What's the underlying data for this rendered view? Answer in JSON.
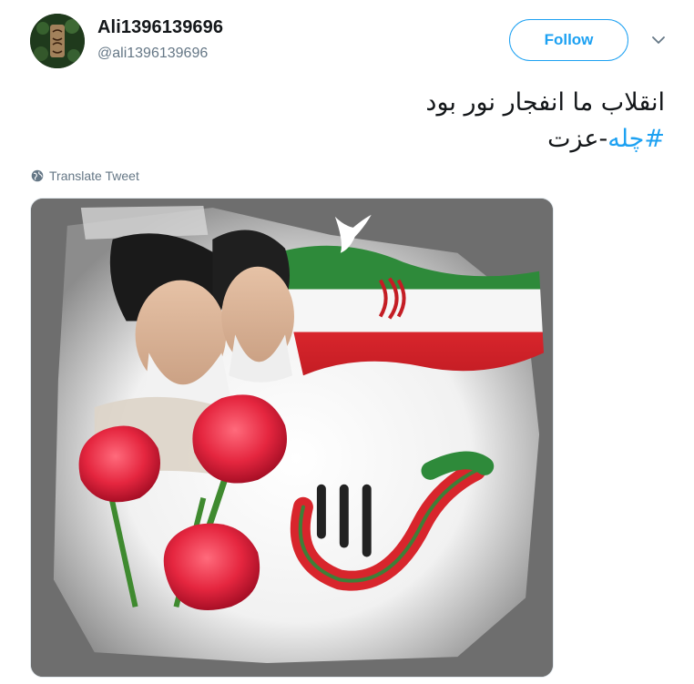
{
  "tweet": {
    "display_name": "Ali1396139696",
    "username": "@ali1396139696",
    "follow_label": "Follow",
    "text_line1": "انقلاب ما انفجار نور بود",
    "hashtag": "#چله",
    "text_suffix": "-عزت",
    "translate_label": "Translate Tweet"
  },
  "media": {
    "calligraphy": "بهمن ۲۲"
  },
  "colors": {
    "accent": "#1da1f2",
    "text": "#14171a",
    "secondary": "#657786"
  },
  "icons": {
    "avatar": "avatar",
    "more": "chevron-down-icon",
    "translate": "globe-icon"
  }
}
